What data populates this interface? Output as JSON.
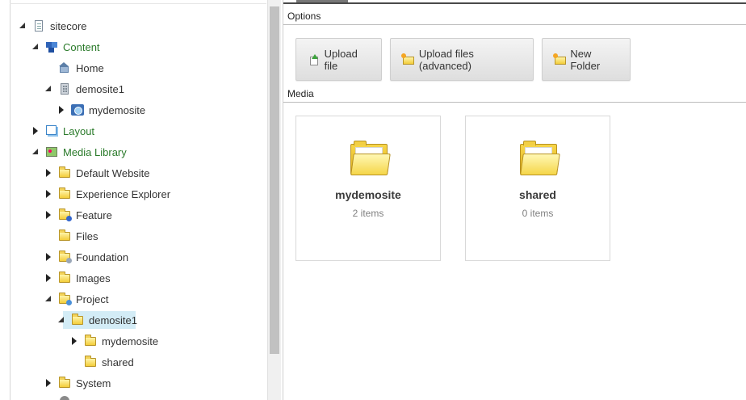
{
  "tree": {
    "items": [
      {
        "label": "sitecore"
      },
      {
        "label": "Content"
      },
      {
        "label": "Home"
      },
      {
        "label": "demosite1"
      },
      {
        "label": "mydemosite"
      },
      {
        "label": "Layout"
      },
      {
        "label": "Media Library"
      },
      {
        "label": "Default Website"
      },
      {
        "label": "Experience Explorer"
      },
      {
        "label": "Feature"
      },
      {
        "label": "Files"
      },
      {
        "label": "Foundation"
      },
      {
        "label": "Images"
      },
      {
        "label": "Project"
      },
      {
        "label": "demosite1"
      },
      {
        "label": "mydemosite"
      },
      {
        "label": "shared"
      },
      {
        "label": "System"
      }
    ]
  },
  "options": {
    "title": "Options",
    "buttons": {
      "upload_file": "Upload file",
      "upload_advanced": "Upload files (advanced)",
      "new_folder": "New Folder"
    }
  },
  "media": {
    "title": "Media",
    "tiles": [
      {
        "name": "mydemosite",
        "count": "2 items"
      },
      {
        "name": "shared",
        "count": "0 items"
      }
    ]
  },
  "colors": {
    "selection": "#d3ecf6",
    "green_label": "#2a7a2a",
    "folder": "#f3cd3a"
  }
}
